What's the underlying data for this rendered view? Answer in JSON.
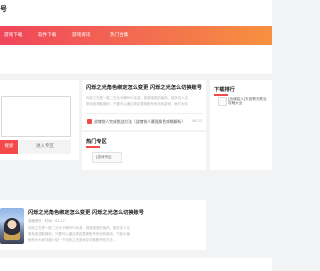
{
  "header": {
    "site_name": "号"
  },
  "nav": {
    "items": [
      "游戏下载",
      "软件下载",
      "游戏资讯",
      "热门合集"
    ]
  },
  "left": {
    "primary_button": "搜索",
    "secondary_button": "进入专区"
  },
  "article": {
    "title": "闪烁之光角色绑定怎么变更 闪烁之光怎么切换账号",
    "summary_lines": [
      "闪烁之光是一款二次元卡牌RPG手游，精致唯美的画风，超多名人名",
      "角免费领取福利，只要可以通过绑定更换账号来玩转游戏，我们为你"
    ],
    "related_link": "战魂铭人完成挑战方法（战魂铭人最强角色攻略解析）",
    "related_date": "06-23"
  },
  "hot_zone": {
    "title": "热门专区",
    "image_alt": "[游戏专区"
  },
  "sidebar": {
    "title": "下载排行",
    "item_text": "[战魂铭人]天宫教天联合攻略大全"
  },
  "bottom_article": {
    "title": "闪烁之光角色绑定怎么变更 闪烁之光怎么切换账号",
    "meta": "攻略资讯 · 时间：02-17",
    "summary_lines": [
      "闪烁之光是一款二次元卡牌RPG手游，精致唯美的画风，超多名人名",
      "角免费领取福利，只要可以通过绑定更换账号来玩转游戏，下面小编",
      "就来为大家详细介绍一下闪烁之光游戏中切换账号的方法..."
    ]
  }
}
